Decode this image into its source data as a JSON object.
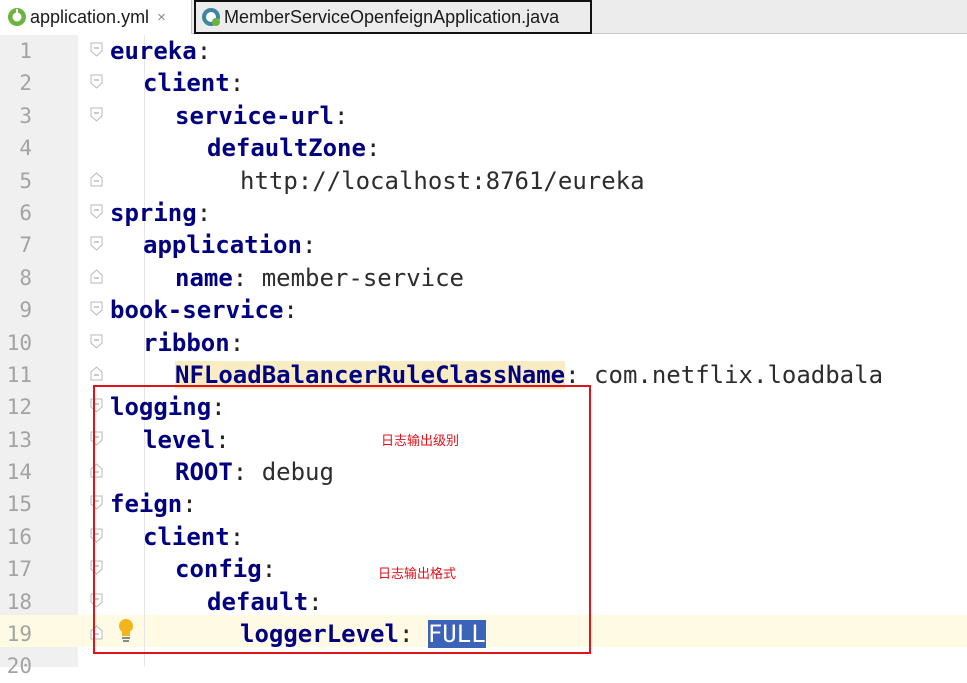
{
  "tabs": [
    {
      "label": "application.yml",
      "close": "×",
      "icon": "spring-leaf-icon"
    },
    {
      "label": "MemberServiceOpenfeignApplication.java",
      "icon": "java-class-icon"
    }
  ],
  "colors": {
    "key": "#000080",
    "red_box": "#e0121a",
    "selection": "#3b63b8",
    "current_line": "#fffae3"
  },
  "notes": {
    "log_level": "日志输出级别",
    "log_format": "日志输出格式"
  },
  "lines": [
    {
      "n": "1",
      "key": "eureka",
      "punct": ":",
      "value": ""
    },
    {
      "n": "2",
      "key": "client",
      "punct": ":",
      "value": ""
    },
    {
      "n": "3",
      "key": "service-url",
      "punct": ":",
      "value": ""
    },
    {
      "n": "4",
      "key": "defaultZone",
      "punct": ":",
      "value": ""
    },
    {
      "n": "5",
      "key": "",
      "punct": "",
      "value": "http://localhost:8761/eureka"
    },
    {
      "n": "6",
      "key": "spring",
      "punct": ":",
      "value": ""
    },
    {
      "n": "7",
      "key": "application",
      "punct": ":",
      "value": ""
    },
    {
      "n": "8",
      "key": "name",
      "punct": ": ",
      "value": "member-service"
    },
    {
      "n": "9",
      "key": "book-service",
      "punct": ":",
      "value": ""
    },
    {
      "n": "10",
      "key": "ribbon",
      "punct": ":",
      "value": ""
    },
    {
      "n": "11",
      "key": "NFLoadBalancerRuleClassName",
      "punct": ": ",
      "value": "com.netflix.loadbala"
    },
    {
      "n": "12",
      "key": "logging",
      "punct": ":",
      "value": ""
    },
    {
      "n": "13",
      "key": "level",
      "punct": ":",
      "value": ""
    },
    {
      "n": "14",
      "key": "ROOT",
      "punct": ": ",
      "value": "debug"
    },
    {
      "n": "15",
      "key": "feign",
      "punct": ":",
      "value": ""
    },
    {
      "n": "16",
      "key": "client",
      "punct": ":",
      "value": ""
    },
    {
      "n": "17",
      "key": "config",
      "punct": ":",
      "value": ""
    },
    {
      "n": "18",
      "key": "default",
      "punct": ":",
      "value": ""
    },
    {
      "n": "19",
      "key": "loggerLevel",
      "punct": ": ",
      "value": "FULL"
    },
    {
      "n": "20",
      "key": "",
      "punct": "",
      "value": ""
    }
  ]
}
